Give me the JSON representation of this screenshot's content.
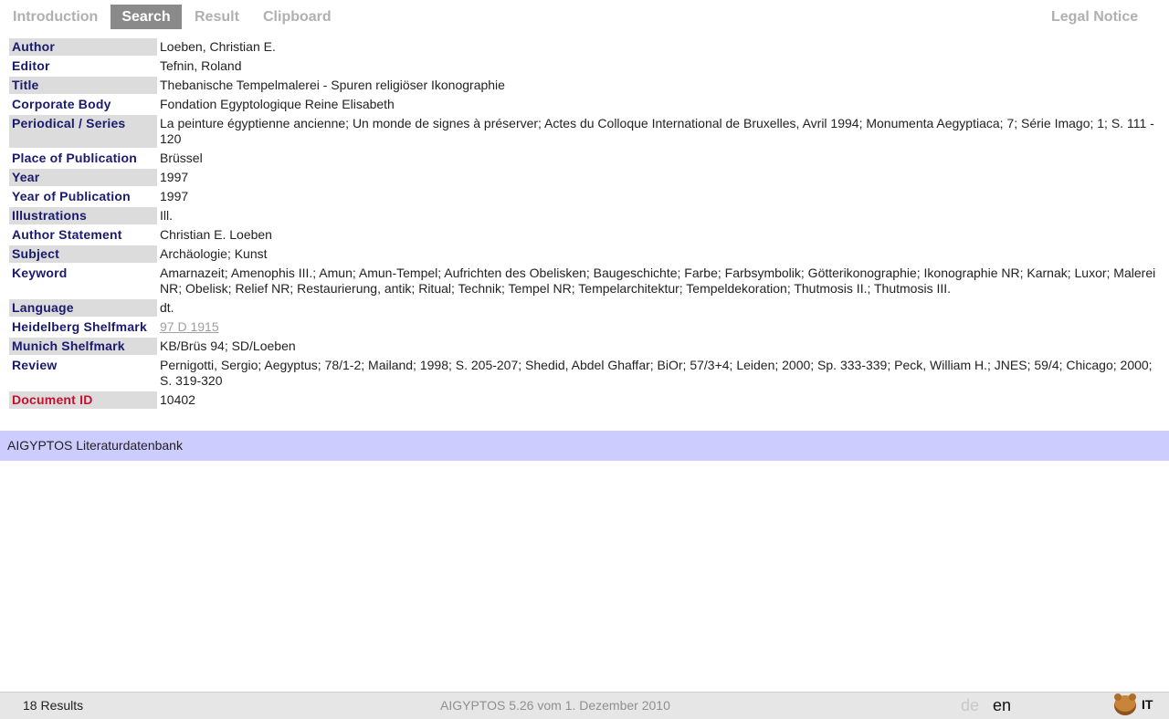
{
  "nav": {
    "tabs": [
      {
        "label": "Introduction",
        "active": false
      },
      {
        "label": "Search",
        "active": true
      },
      {
        "label": "Result",
        "active": false
      },
      {
        "label": "Clipboard",
        "active": false
      }
    ],
    "legal": "Legal Notice"
  },
  "record": {
    "rows": [
      {
        "label": "Author",
        "value": "Loeben, Christian E."
      },
      {
        "label": "Editor",
        "value": "Tefnin, Roland"
      },
      {
        "label": "Title",
        "value": "Thebanische Tempelmalerei - Spuren religiöser Ikonographie"
      },
      {
        "label": "Corporate Body",
        "value": "Fondation Egyptologique Reine Elisabeth"
      },
      {
        "label": "Periodical / Series",
        "value": "La peinture égyptienne ancienne; Un monde de signes à préserver; Actes du Colloque International de Bruxelles, Avril 1994; Monumenta Aegyptiaca; 7; Série Imago; 1; S. 111 - 120"
      },
      {
        "label": "Place of Publication",
        "value": "Brüssel"
      },
      {
        "label": "Year",
        "value": "1997"
      },
      {
        "label": "Year of Publication",
        "value": "1997"
      },
      {
        "label": "Illustrations",
        "value": "Ill."
      },
      {
        "label": "Author Statement",
        "value": "Christian E. Loeben"
      },
      {
        "label": "Subject",
        "value": "Archäologie; Kunst"
      },
      {
        "label": "Keyword",
        "value": "Amarnazeit; Amenophis III.; Amun; Amun-Tempel; Aufrichten des Obelisken; Baugeschichte; Farbe; Farbsymbolik; Götterikonographie; Ikonographie NR; Karnak; Luxor; Malerei NR; Obelisk; Relief NR; Restaurierung, antik; Ritual; Technik; Tempel NR; Tempelarchitektur; Tempeldekoration; Thutmosis II.; Thutmosis III."
      },
      {
        "label": "Language",
        "value": "dt."
      },
      {
        "label": "Heidelberg Shelfmark",
        "value": "97 D 1915"
      },
      {
        "label": "Munich Shelfmark",
        "value": "KB/Brüs 94; SD/Loeben"
      },
      {
        "label": "Review",
        "value": "Pernigotti, Sergio; Aegyptus; 78/1-2; Mailand; 1998; S. 205-207; Shedid, Abdel Ghaffar; BiOr; 57/3+4; Leiden; 2000; Sp. 333-339; Peck, William H.; JNES; 59/4; Chicago; 2000; S. 319-320"
      },
      {
        "label": "Document ID",
        "value": "10402"
      }
    ]
  },
  "band": {
    "text": "AIGYPTOS Literaturdatenbank"
  },
  "status": {
    "results": "18 Results",
    "version": "AIGYPTOS 5.26 vom 1. Dezember 2010",
    "lang_de": "de",
    "lang_en": "en",
    "logo_text": "IT"
  },
  "colors": {
    "label": "#1a1a6e",
    "docid": "#c8102e",
    "band": "#ccccff",
    "active_tab": "#8a8a8a"
  },
  "icons": {
    "logo": "bear-icon"
  }
}
